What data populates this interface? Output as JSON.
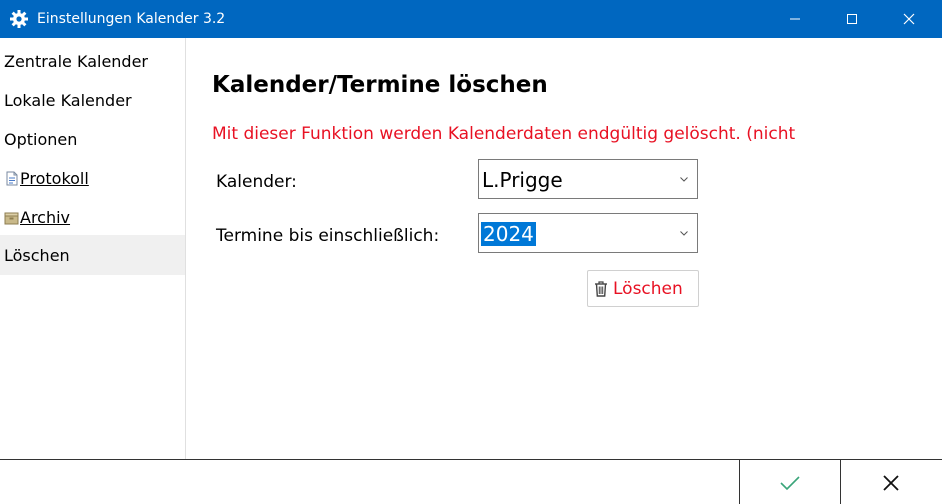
{
  "window": {
    "title": "Einstellungen Kalender 3.2",
    "icon": "gear-icon"
  },
  "sidebar": {
    "items": [
      {
        "label": "Zentrale Kalender"
      },
      {
        "label": "Lokale Kalender"
      },
      {
        "label": "Optionen"
      },
      {
        "label": "Protokoll",
        "icon": "document-icon"
      },
      {
        "label": "Archiv",
        "icon": "archive-box-icon"
      },
      {
        "label": "Löschen",
        "active": true
      }
    ]
  },
  "main": {
    "heading": "Kalender/Termine löschen",
    "warning": "Mit dieser Funktion werden Kalenderdaten endgültig gelöscht. (nicht",
    "kalender_label": "Kalender:",
    "kalender_value": "L.Prigge",
    "termine_label": "Termine bis einschließlich:",
    "termine_value": "2024",
    "delete_label": "Löschen"
  },
  "colors": {
    "titlebar": "#0067c0",
    "warning": "#e81123",
    "ok": "#3aa57a",
    "selection": "#0078d7"
  }
}
